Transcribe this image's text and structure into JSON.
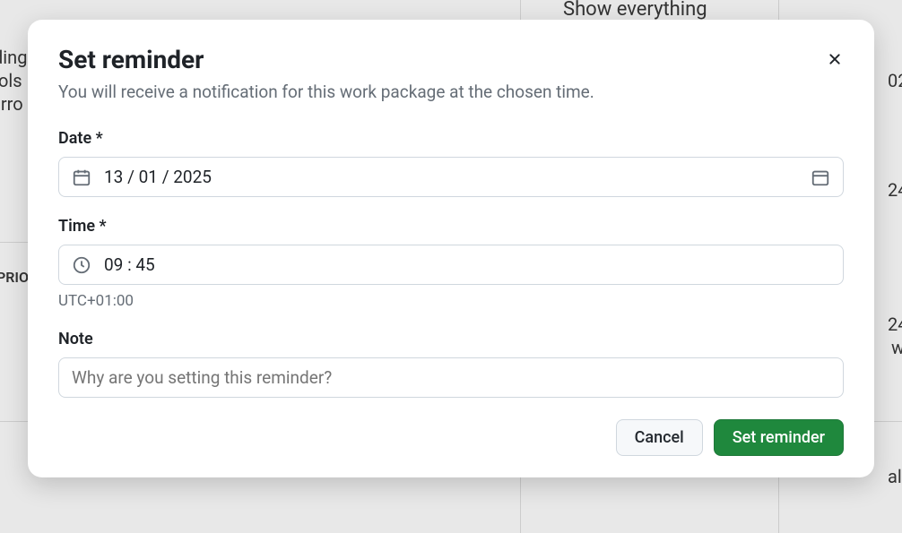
{
  "modal": {
    "title": "Set reminder",
    "subtitle": "You will receive a notification for this work package at the chosen time."
  },
  "form": {
    "date": {
      "label": "Date *",
      "value": "13 / 01 / 2025"
    },
    "time": {
      "label": "Time *",
      "value": "09 : 45",
      "tz": "UTC+01:00"
    },
    "note": {
      "label": "Note",
      "placeholder": "Why are you setting this reminder?"
    }
  },
  "actions": {
    "cancel": "Cancel",
    "submit": "Set reminder"
  },
  "background": {
    "frag1": "ding",
    "frag2": "ols",
    "frag3": "irro",
    "frag4": "PRIO",
    "frag5": "Show everything",
    "frag6": "02",
    "frag7": "24",
    "frag8": "24",
    "frag9": "w",
    "frag10": "al"
  }
}
